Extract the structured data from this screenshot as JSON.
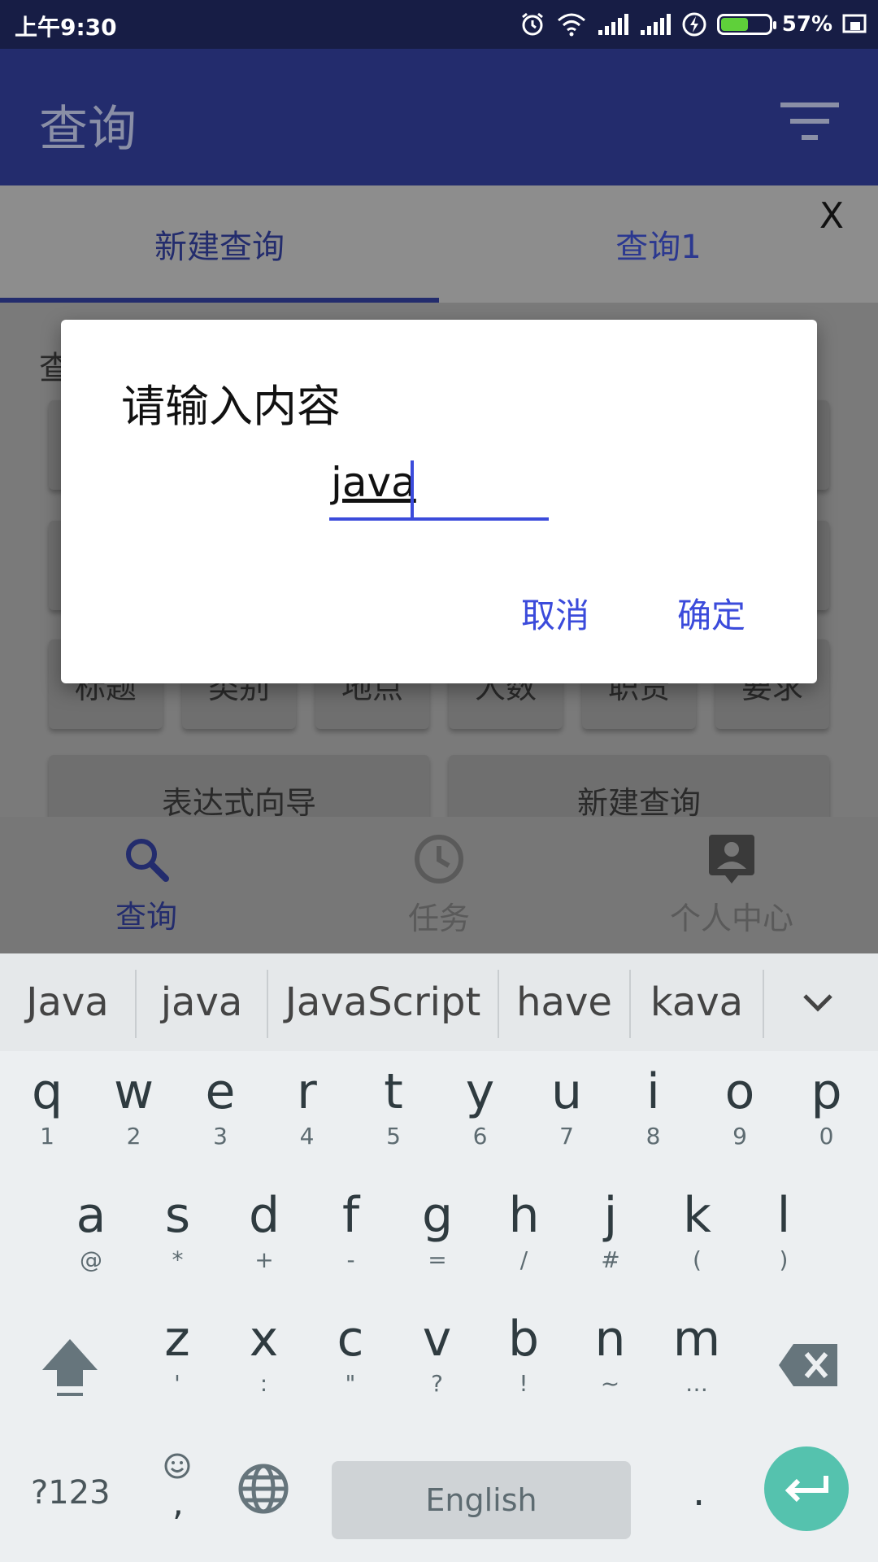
{
  "status": {
    "time": "上午9:30",
    "battery_pct": "57%",
    "battery_level": 0.57
  },
  "appbar": {
    "title": "查询"
  },
  "tabs": {
    "items": [
      "新建查询",
      "查询1"
    ],
    "close": "X"
  },
  "content": {
    "section_label": "查",
    "chips": [
      "标题",
      "类别",
      "地点",
      "人数",
      "职责",
      "要求"
    ],
    "buttons": [
      "表达式向导",
      "新建查询"
    ]
  },
  "bottom_nav": {
    "items": [
      "查询",
      "任务",
      "个人中心"
    ]
  },
  "dialog": {
    "title": "请输入内容",
    "input_value": "java",
    "cancel": "取消",
    "confirm": "确定"
  },
  "keyboard": {
    "suggestions": [
      "Java",
      "java",
      "JavaScript",
      "have",
      "kava"
    ],
    "row1": [
      {
        "c": "q",
        "n": "1"
      },
      {
        "c": "w",
        "n": "2"
      },
      {
        "c": "e",
        "n": "3"
      },
      {
        "c": "r",
        "n": "4"
      },
      {
        "c": "t",
        "n": "5"
      },
      {
        "c": "y",
        "n": "6"
      },
      {
        "c": "u",
        "n": "7"
      },
      {
        "c": "i",
        "n": "8"
      },
      {
        "c": "o",
        "n": "9"
      },
      {
        "c": "p",
        "n": "0"
      }
    ],
    "row2": [
      {
        "c": "a",
        "n": "@"
      },
      {
        "c": "s",
        "n": "*"
      },
      {
        "c": "d",
        "n": "+"
      },
      {
        "c": "f",
        "n": "-"
      },
      {
        "c": "g",
        "n": "="
      },
      {
        "c": "h",
        "n": "/"
      },
      {
        "c": "j",
        "n": "#"
      },
      {
        "c": "k",
        "n": "("
      },
      {
        "c": "l",
        "n": ")"
      }
    ],
    "row3": [
      {
        "c": "z",
        "n": "'"
      },
      {
        "c": "x",
        "n": ":"
      },
      {
        "c": "c",
        "n": "\""
      },
      {
        "c": "v",
        "n": "?"
      },
      {
        "c": "b",
        "n": "!"
      },
      {
        "c": "n",
        "n": "~"
      },
      {
        "c": "m",
        "n": "…"
      }
    ],
    "symbols_label": "?123",
    "emoji_comma": ",",
    "space_label": "English",
    "period": "."
  },
  "colors": {
    "primary": "#232c6d",
    "accent": "#3b4bdb",
    "enter": "#55c2ae"
  }
}
